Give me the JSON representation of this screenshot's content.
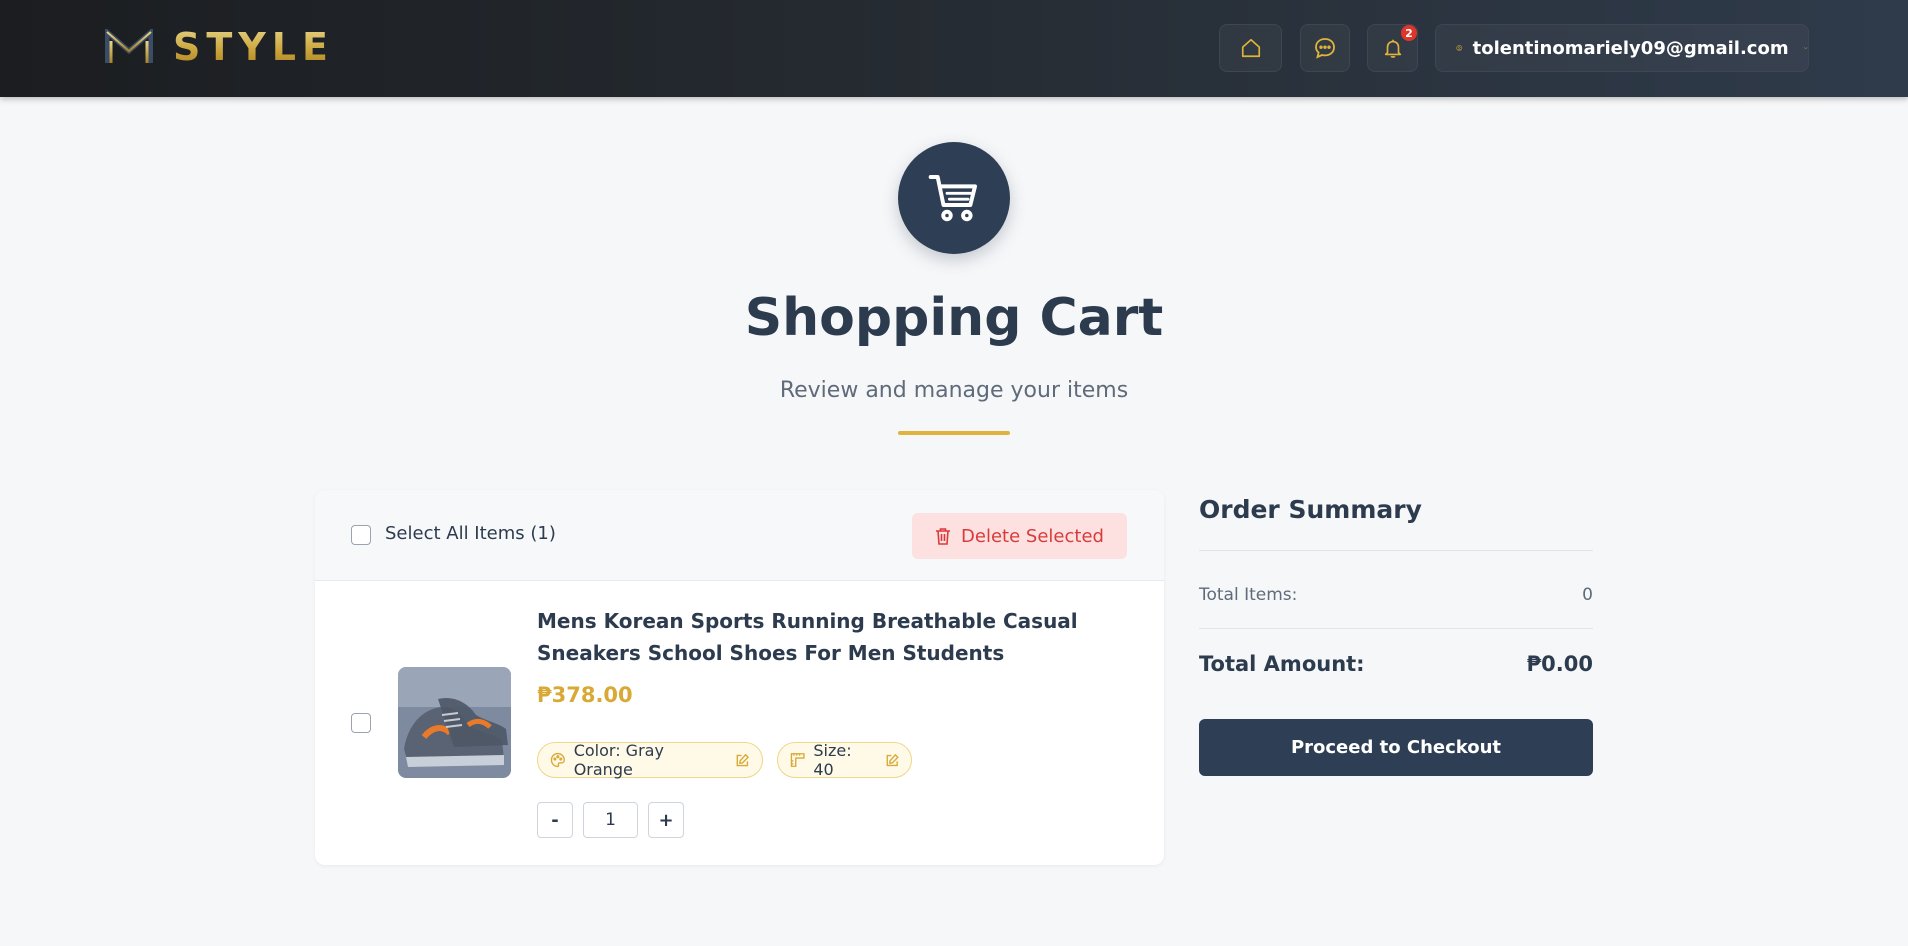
{
  "header": {
    "logo_text": "STYLE",
    "notification_count": "2",
    "user_email": "tolentinomariely09@gmail.com",
    "icons": [
      "home-icon",
      "chat-icon",
      "bell-icon",
      "user-circle-icon",
      "chevron-down-icon"
    ]
  },
  "hero": {
    "title": "Shopping Cart",
    "subtitle": "Review and manage your items"
  },
  "cart": {
    "select_all_label": "Select All Items (1)",
    "delete_selected_label": "Delete Selected",
    "items": [
      {
        "name": "Mens Korean Sports Running Breathable Casual Sneakers School Shoes For Men Students",
        "price": "₱378.00",
        "color": "Color: Gray Orange",
        "size": "Size: 40",
        "quantity": "1",
        "minus_label": "-",
        "plus_label": "+",
        "checked": false
      }
    ]
  },
  "summary": {
    "title": "Order Summary",
    "total_items_label": "Total Items:",
    "total_items_value": "0",
    "total_amount_label": "Total Amount:",
    "total_amount_value": "₱0.00",
    "checkout_label": "Proceed to Checkout"
  },
  "colors": {
    "navy": "#2e3f55",
    "gold": "#d8a935",
    "danger": "#d93b3b",
    "danger_bg": "#fde1e1",
    "background": "#f6f7f9"
  }
}
